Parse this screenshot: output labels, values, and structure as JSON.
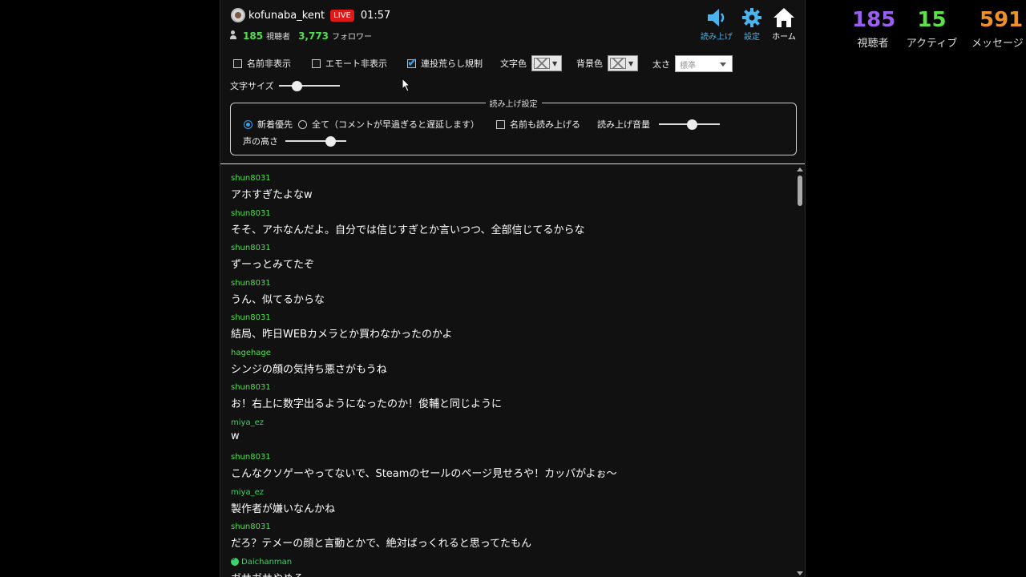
{
  "header": {
    "username": "kofunaba_kent",
    "live_label": "LIVE",
    "elapsed": "01:57",
    "viewers_count": "185",
    "viewers_label": "視聴者",
    "followers_count": "3,773",
    "followers_label": "フォロワー"
  },
  "nav": {
    "tts_label": "読み上げ",
    "settings_label": "設定",
    "home_label": "ホーム"
  },
  "options": {
    "hide_names": "名前非表示",
    "hide_emotes": "エモート非表示",
    "spam_filter": "連投荒らし規制",
    "text_color": "文字色",
    "bg_color": "背景色",
    "weight_label": "太さ",
    "weight_value": "標準",
    "font_size_label": "文字サイズ",
    "font_size_level": 0.25
  },
  "tts": {
    "legend": "読み上げ設定",
    "mode_newest": "新着優先",
    "mode_all": "全て（コメントが早過ぎると遅延します）",
    "read_names": "名前も読み上げる",
    "volume_label": "読み上げ音量",
    "volume_level": 0.55,
    "pitch_label": "声の高さ",
    "pitch_level": 0.8
  },
  "chat": [
    {
      "user": "shun8031",
      "text": "アホすぎたよなw"
    },
    {
      "user": "shun8031",
      "text": "そそ、アホなんだよ。自分では信じすぎとか言いつつ、全部信じてるからな"
    },
    {
      "user": "shun8031",
      "text": "ずーっとみてたぞ"
    },
    {
      "user": "shun8031",
      "text": "うん、似てるからな"
    },
    {
      "user": "shun8031",
      "text": "結局、昨日WEBカメラとか買わなかったのかよ"
    },
    {
      "user": "hagehage",
      "text": "シンジの顔の気持ち悪さがもうね"
    },
    {
      "user": "shun8031",
      "text": "お！右上に数字出るようになったのか！俊輔と同じように"
    },
    {
      "user": "miya_ez",
      "text": "w"
    },
    {
      "user": "shun8031",
      "text": "こんなクソゲーやってないで、Steamのセールのページ見せろや！カッパがよぉ～"
    },
    {
      "user": "miya_ez",
      "text": "製作者が嫌いなんかね"
    },
    {
      "user": "shun8031",
      "text": "だろ？テメーの顔と言動とかで、絶対ばっくれると思ってたもん"
    },
    {
      "user": "Daichanman",
      "text": "ガサガサやめろ"
    }
  ],
  "overlay": {
    "viewers_value": "185",
    "viewers_label": "視聴者",
    "active_value": "15",
    "active_label": "アクティブ",
    "messages_value": "591",
    "messages_label": "メッセージ"
  },
  "colors": {
    "viewers": "#9b5ff0",
    "active": "#5ee04a",
    "messages": "#f0902a",
    "username_green": "#4ee04e",
    "accent_blue": "#4ab4ef",
    "live_red": "#e01818"
  }
}
